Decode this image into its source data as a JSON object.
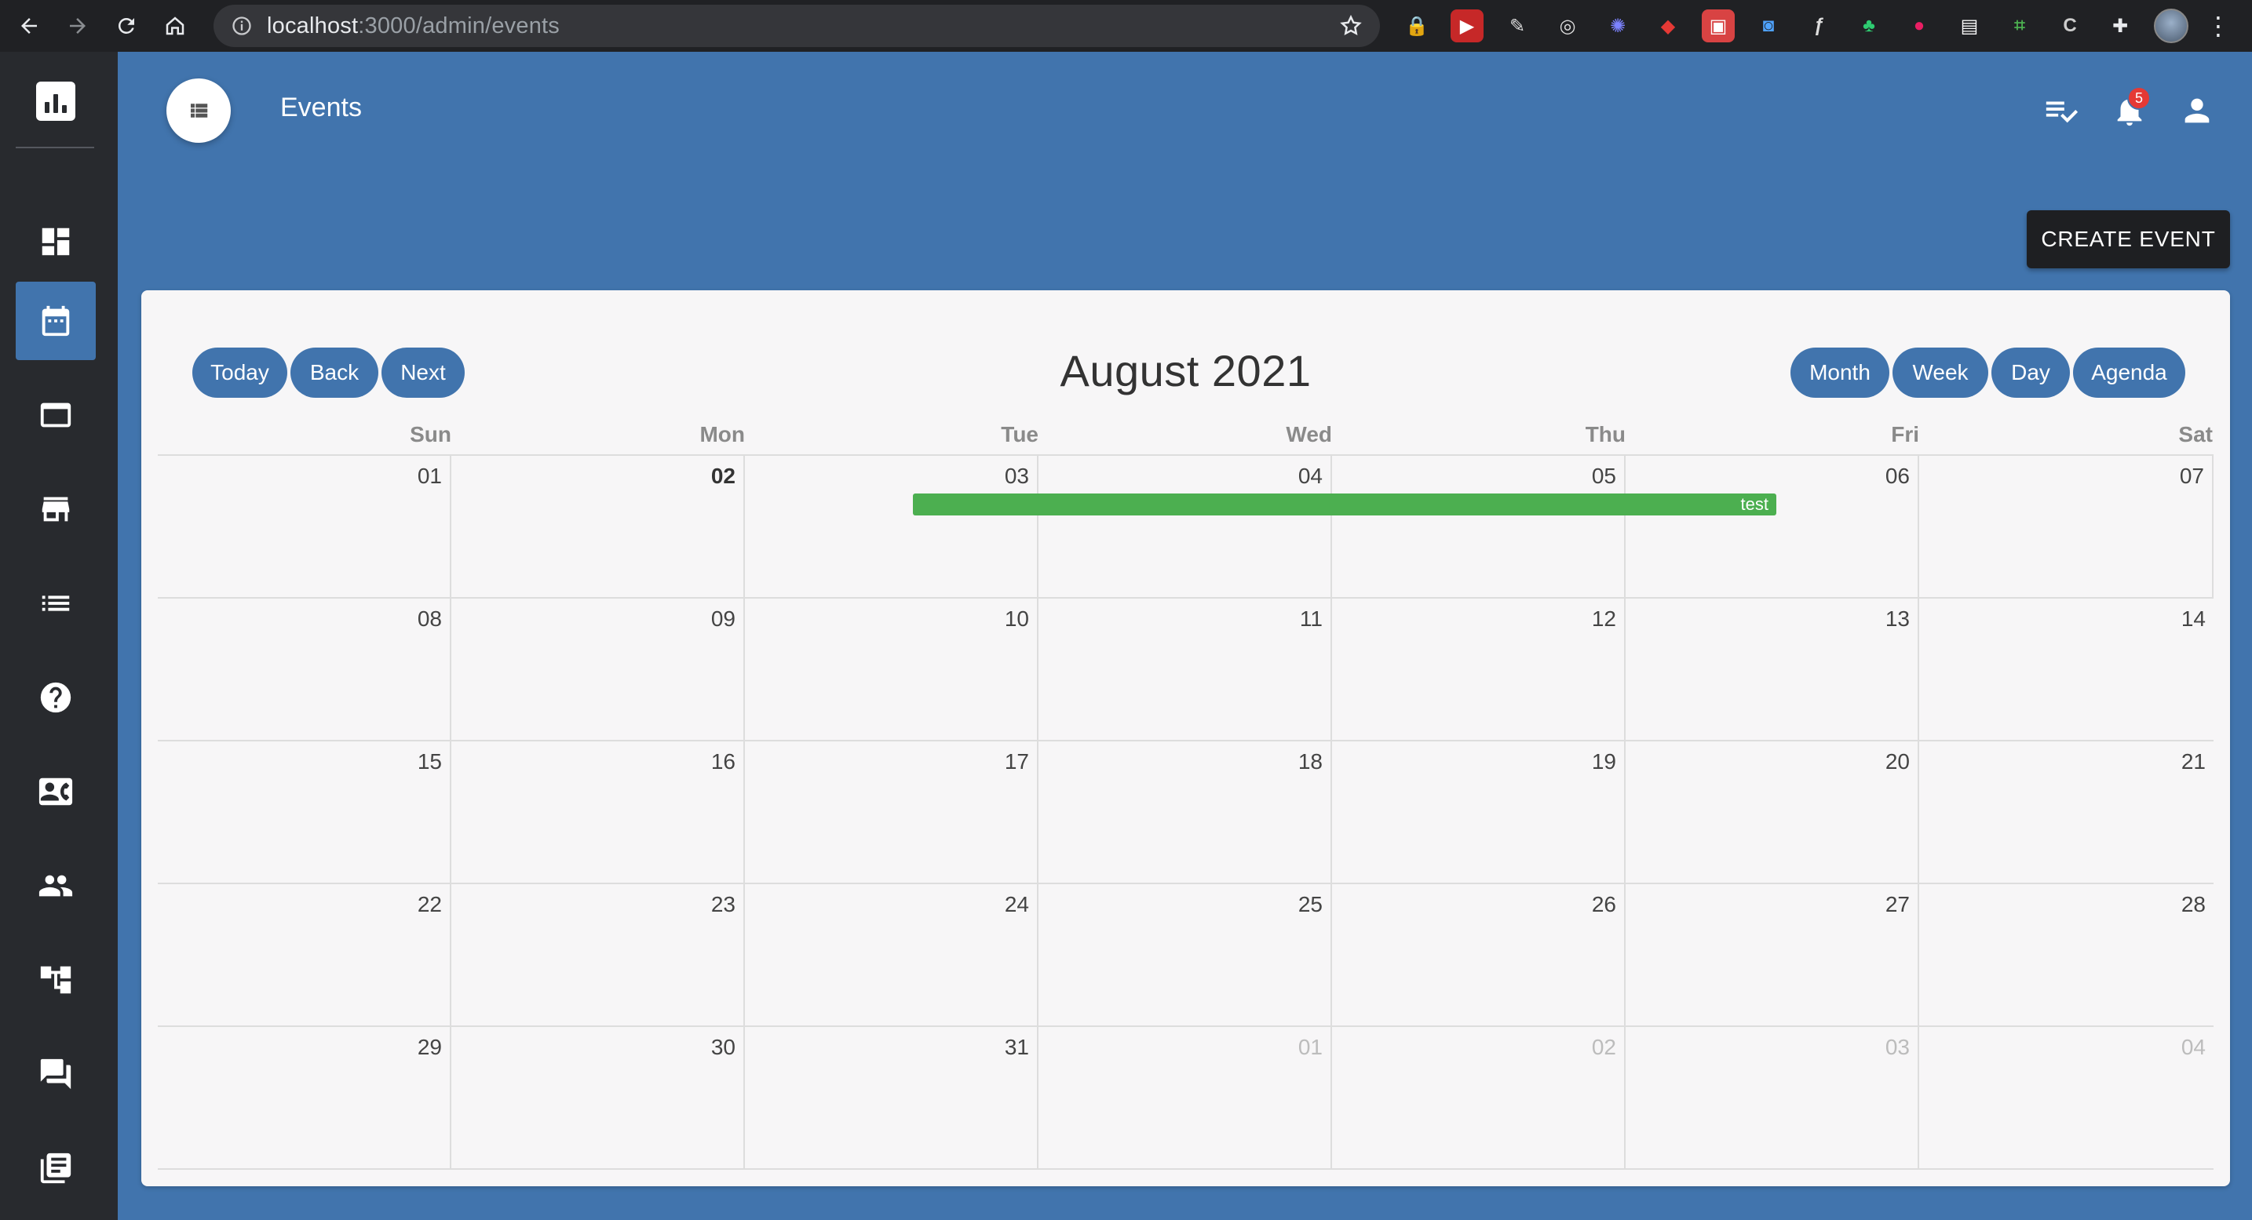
{
  "browser": {
    "url_host": "localhost",
    "url_path": ":3000/admin/events"
  },
  "header": {
    "title": "Events",
    "notification_count": "5"
  },
  "actions": {
    "create_event": "CREATE EVENT"
  },
  "calendar": {
    "title": "August 2021",
    "nav": {
      "today": "Today",
      "back": "Back",
      "next": "Next"
    },
    "views": {
      "month": "Month",
      "week": "Week",
      "day": "Day",
      "agenda": "Agenda"
    },
    "weekdays": [
      "Sun",
      "Mon",
      "Tue",
      "Wed",
      "Thu",
      "Fri",
      "Sat"
    ],
    "weeks": [
      [
        "01",
        "02",
        "03",
        "04",
        "05",
        "06",
        "07"
      ],
      [
        "08",
        "09",
        "10",
        "11",
        "12",
        "13",
        "14"
      ],
      [
        "15",
        "16",
        "17",
        "18",
        "19",
        "20",
        "21"
      ],
      [
        "22",
        "23",
        "24",
        "25",
        "26",
        "27",
        "28"
      ],
      [
        "29",
        "30",
        "31",
        "01",
        "02",
        "03",
        "04"
      ]
    ],
    "today_date": "02",
    "event": {
      "title": "test",
      "color": "#4caf50"
    }
  },
  "colors": {
    "accent": "#4174ad",
    "sidebar": "#282a2e",
    "create_button": "#1e1f22"
  },
  "sidebar": {
    "items": [
      {
        "icon": "dashboard-icon"
      },
      {
        "icon": "calendar-icon",
        "active": true
      },
      {
        "icon": "window-icon"
      },
      {
        "icon": "store-icon"
      },
      {
        "icon": "list-icon"
      },
      {
        "icon": "help-icon"
      },
      {
        "icon": "contact-card-icon"
      },
      {
        "icon": "people-icon"
      },
      {
        "icon": "hierarchy-icon"
      },
      {
        "icon": "forum-icon"
      },
      {
        "icon": "library-books-icon"
      }
    ]
  }
}
